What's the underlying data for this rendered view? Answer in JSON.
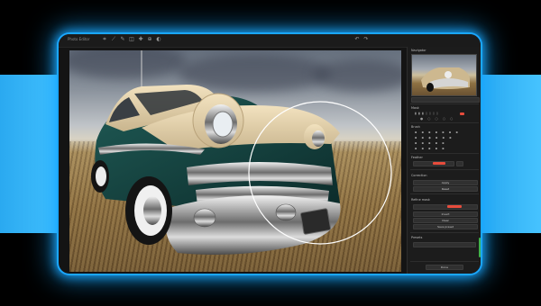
{
  "window": {
    "title": "Photo Editor"
  },
  "toolbar": {
    "left_tools": [
      "crop-icon",
      "straighten-icon",
      "brush-icon",
      "eraser-icon",
      "heal-icon",
      "clone-icon",
      "gradient-icon"
    ],
    "right_tools": [
      "undo-icon",
      "redo-icon"
    ]
  },
  "panel": {
    "navigator_label": "Navigator",
    "sections": [
      "Mask",
      "Brushes",
      "Correction",
      "Refinements",
      "Presets"
    ],
    "labels": [
      "Navigator",
      "Mask",
      "Brush",
      "Feather",
      "Correction",
      "Refine mask",
      "Presets"
    ],
    "buttons": [
      "Apply",
      "Reset",
      "Invert",
      "Clear",
      "Save preset",
      "Done"
    ]
  },
  "accent_colors": {
    "glow": "#1aa7ff",
    "selection": "#e74c3c",
    "ok": "#3fb34f"
  }
}
